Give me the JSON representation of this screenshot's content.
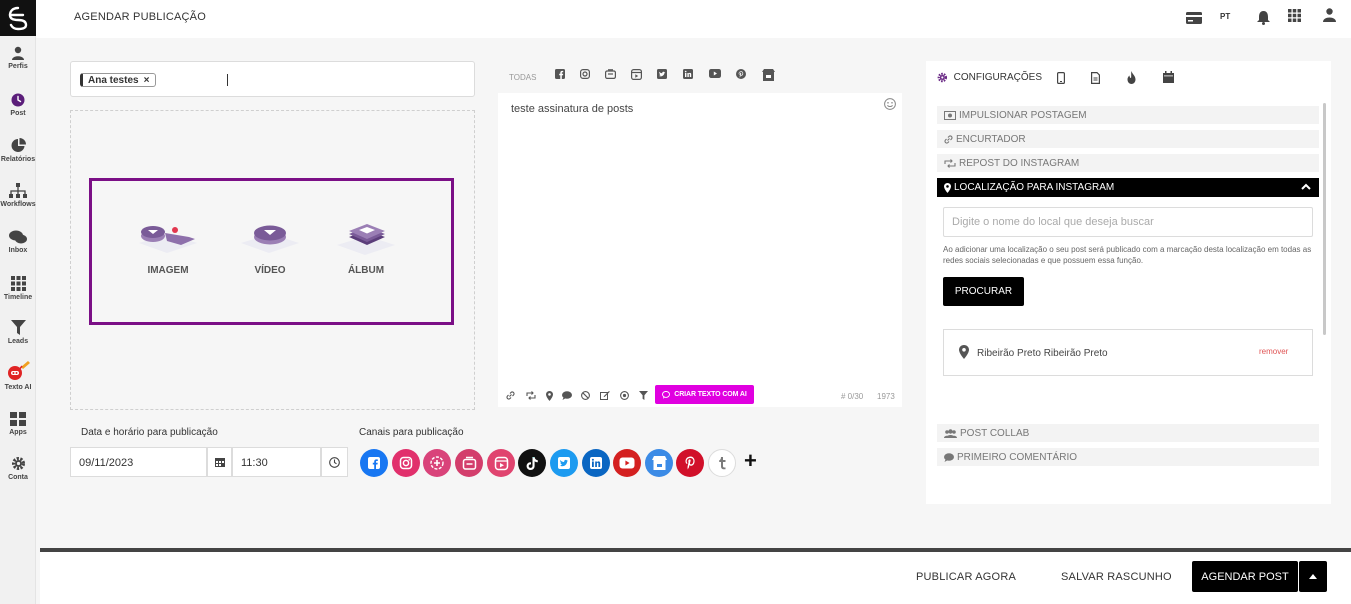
{
  "header": {
    "title": "AGENDAR PUBLICAÇÃO",
    "language": "PT"
  },
  "sidebar": {
    "items": [
      {
        "label": "Perfis",
        "icon": "user-icon"
      },
      {
        "label": "Post",
        "icon": "clock-icon"
      },
      {
        "label": "Relatórios",
        "icon": "pie-chart-icon"
      },
      {
        "label": "Workflows",
        "icon": "sitemap-icon"
      },
      {
        "label": "Inbox",
        "icon": "chat-icon"
      },
      {
        "label": "Timeline",
        "icon": "grid-icon"
      },
      {
        "label": "Leads",
        "icon": "filter-icon"
      },
      {
        "label": "Texto AI",
        "icon": "robot-icon"
      },
      {
        "label": "Apps",
        "icon": "apps-icon"
      },
      {
        "label": "Conta",
        "icon": "gear-icon"
      }
    ]
  },
  "composer": {
    "recipient_chip": "Ana testes",
    "chip_remove": "×",
    "media_options": [
      {
        "label": "IMAGEM",
        "icon": "image-icon"
      },
      {
        "label": "VÍDEO",
        "icon": "video-icon"
      },
      {
        "label": "ÁLBUM",
        "icon": "album-icon"
      }
    ],
    "schedule_label": "Data e horário para publicação",
    "date_value": "09/11/2023",
    "time_value": "11:30",
    "channels_label": "Canais para publicação",
    "channels": [
      {
        "name": "facebook",
        "color": "#1877f2"
      },
      {
        "name": "instagram",
        "color": "#e1306c"
      },
      {
        "name": "instagram-stories",
        "color": "#d9437a"
      },
      {
        "name": "instagram-carousel",
        "color": "#d33e6c"
      },
      {
        "name": "instagram-reels",
        "color": "#e0446f"
      },
      {
        "name": "tiktok",
        "color": "#111111"
      },
      {
        "name": "twitter",
        "color": "#1d9bf0"
      },
      {
        "name": "linkedin",
        "color": "#0a66c2"
      },
      {
        "name": "youtube",
        "color": "#d42020"
      },
      {
        "name": "google-business",
        "color": "#3b8be6"
      },
      {
        "name": "pinterest",
        "color": "#d1102a"
      },
      {
        "name": "tumblr",
        "color": "#ffffff"
      }
    ]
  },
  "editor": {
    "tab_all": "TODAS",
    "text": "teste assinatura de posts",
    "ai_button": "CRIAR TEXTO COM AI",
    "hashtag_count": "# 0/30",
    "char_count": "1973"
  },
  "settings": {
    "tab_label": "CONFIGURAÇÕES",
    "sections": {
      "boost": "IMPULSIONAR POSTAGEM",
      "shortener": "ENCURTADOR",
      "repost": "REPOST DO INSTAGRAM",
      "location": "LOCALIZAÇÃO PARA INSTAGRAM",
      "collab": "POST COLLAB",
      "first_comment": "PRIMEIRO COMENTÁRIO"
    },
    "location_placeholder": "Digite o nome do local que deseja buscar",
    "location_help": "Ao adicionar uma localização o seu post será publicado com a marcação desta localização em todas as redes sociais selecionadas e que possuem essa função.",
    "search_button": "PROCURAR",
    "selected_location": "Ribeirão Preto Ribeirão Preto",
    "remove_label": "remover"
  },
  "footer": {
    "publish_now": "PUBLICAR AGORA",
    "save_draft": "SALVAR RASCUNHO",
    "schedule_post": "AGENDAR POST"
  }
}
